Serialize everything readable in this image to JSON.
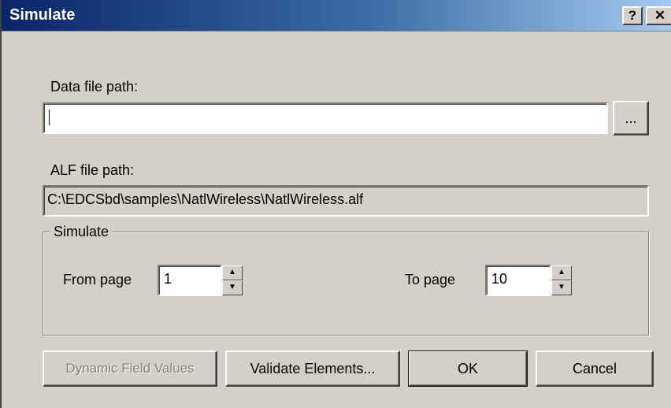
{
  "window": {
    "title": "Simulate",
    "help_button": "?",
    "close_button": "✕"
  },
  "data_file": {
    "label": "Data file path:",
    "value": "",
    "browse_label": "..."
  },
  "alf_file": {
    "label": "ALF file path:",
    "value": "C:\\EDCSbd\\samples\\NatlWireless\\NatlWireless.alf"
  },
  "simulate_group": {
    "legend": "Simulate",
    "from_label": "From page",
    "from_value": "1",
    "to_label": "To page",
    "to_value": "10",
    "spin_up": "▲",
    "spin_down": "▼"
  },
  "buttons": {
    "dynamic_field_values": "Dynamic Field Values",
    "validate_elements": "Validate Elements...",
    "ok": "OK",
    "cancel": "Cancel"
  }
}
